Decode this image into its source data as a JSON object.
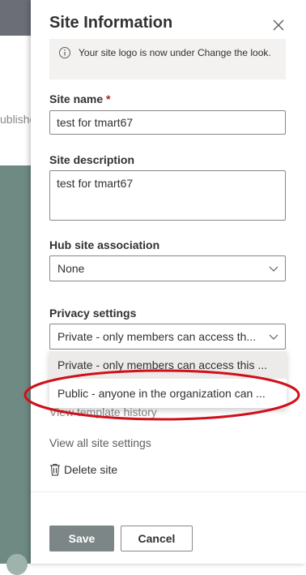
{
  "background": {
    "partial_text": "ublishe"
  },
  "panel": {
    "title": "Site Information",
    "info_message": "Your site logo is now under Change the look.",
    "site_name": {
      "label": "Site name",
      "required_marker": "*",
      "value": "test for tmart67"
    },
    "site_description": {
      "label": "Site description",
      "value": "test for tmart67"
    },
    "hub_site": {
      "label": "Hub site association",
      "selected": "None"
    },
    "privacy": {
      "label": "Privacy settings",
      "selected": "Private - only members can access th...",
      "options": [
        "Private - only members can access this ...",
        "Public - anyone in the organization can ..."
      ]
    },
    "links": {
      "template_history": "View template history",
      "all_settings": "View all site settings",
      "delete_site": "Delete site"
    },
    "buttons": {
      "save": "Save",
      "cancel": "Cancel"
    }
  },
  "colors": {
    "annotation_ellipse": "#d0101b",
    "save_button": "#7d8686",
    "required_asterisk": "#a4262c"
  },
  "icons": [
    "close-icon",
    "info-icon",
    "chevron-down-icon",
    "trash-icon"
  ]
}
